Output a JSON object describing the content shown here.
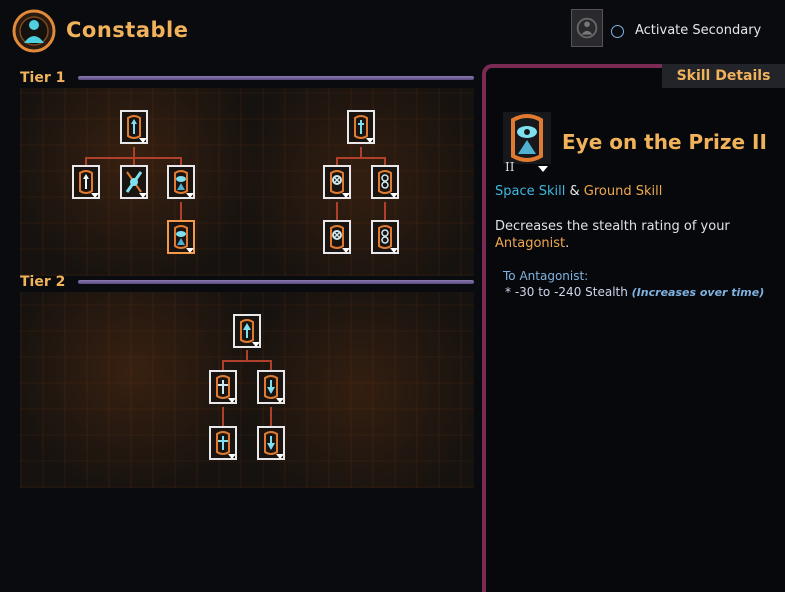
{
  "header": {
    "title": "Constable",
    "secondary_label": "Activate Secondary"
  },
  "tiers": [
    {
      "label": "Tier 1"
    },
    {
      "label": "Tier 2"
    }
  ],
  "details": {
    "tab_label": "Skill Details",
    "rank": "II",
    "skill_name": "Eye on the Prize II",
    "space_skill": "Space Skill",
    "amp": "&",
    "ground_skill": "Ground Skill",
    "description_prefix": "Decreases the stealth rating of your",
    "description_highlight": "Antagonist",
    "description_suffix": ".",
    "target_label": "To Antagonist:",
    "effect_value": "*  -30 to -240 Stealth",
    "effect_note": "(Increases over time)"
  },
  "colors": {
    "accent": "#f0b25a",
    "space": "#3fb8e0",
    "ground": "#f0a850",
    "panel_border": "#7a2a55",
    "connector": "#b0402a"
  }
}
